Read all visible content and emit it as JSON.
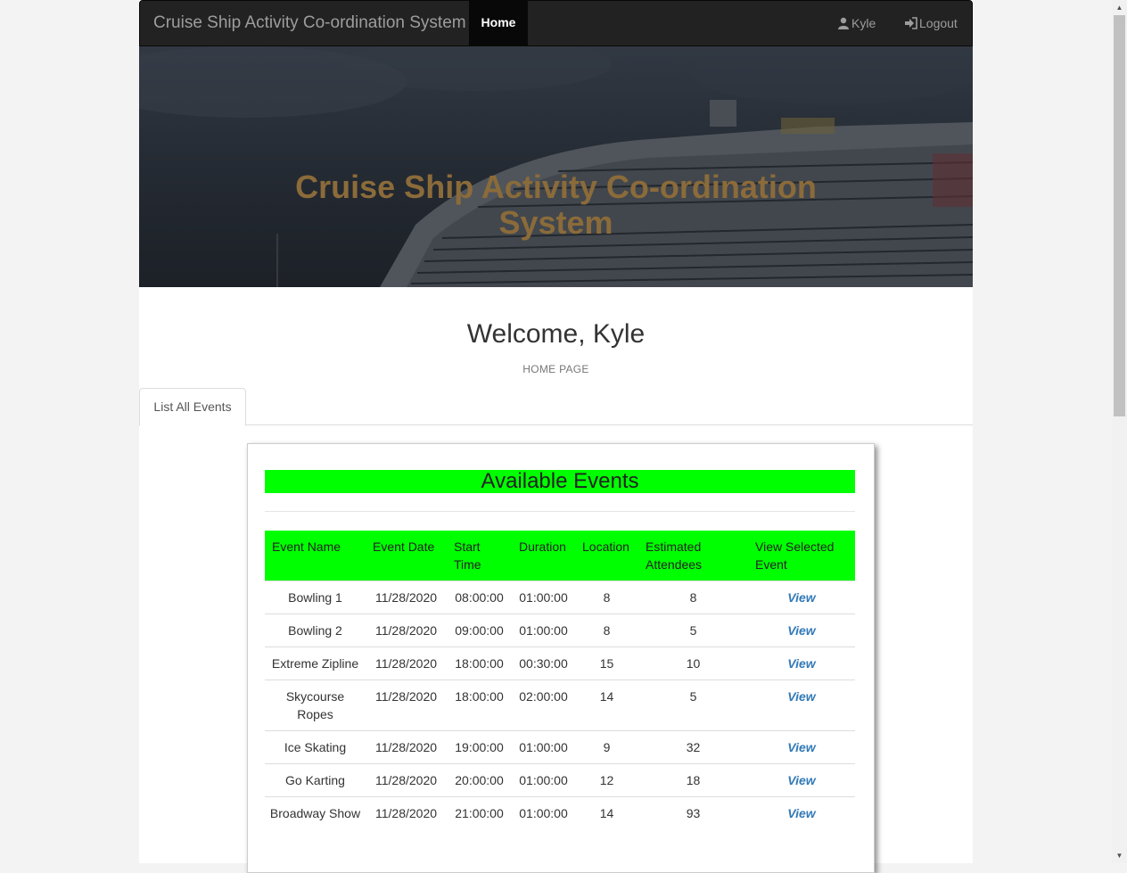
{
  "navbar": {
    "brand": "Cruise Ship Activity Co-ordination System",
    "home": "Home",
    "user": "Kyle",
    "logout": "Logout"
  },
  "hero": {
    "title": "Cruise Ship Activity Co-ordination System"
  },
  "welcome": "Welcome, Kyle",
  "subtitle": "HOME PAGE",
  "tabs": [
    {
      "label": "List All Events"
    }
  ],
  "events": {
    "heading": "Available Events",
    "columns": [
      "Event Name",
      "Event Date",
      "Start Time",
      "Duration",
      "Location",
      "Estimated Attendees",
      "View Selected Event"
    ],
    "rows": [
      {
        "name": "Bowling 1",
        "date": "11/28/2020",
        "start": "08:00:00",
        "duration": "01:00:00",
        "location": "8",
        "attendees": "8",
        "view": "View"
      },
      {
        "name": "Bowling 2",
        "date": "11/28/2020",
        "start": "09:00:00",
        "duration": "01:00:00",
        "location": "8",
        "attendees": "5",
        "view": "View"
      },
      {
        "name": "Extreme Zipline",
        "date": "11/28/2020",
        "start": "18:00:00",
        "duration": "00:30:00",
        "location": "15",
        "attendees": "10",
        "view": "View"
      },
      {
        "name": "Skycourse Ropes",
        "date": "11/28/2020",
        "start": "18:00:00",
        "duration": "02:00:00",
        "location": "14",
        "attendees": "5",
        "view": "View"
      },
      {
        "name": "Ice Skating",
        "date": "11/28/2020",
        "start": "19:00:00",
        "duration": "01:00:00",
        "location": "9",
        "attendees": "32",
        "view": "View"
      },
      {
        "name": "Go Karting",
        "date": "11/28/2020",
        "start": "20:00:00",
        "duration": "01:00:00",
        "location": "12",
        "attendees": "18",
        "view": "View"
      },
      {
        "name": "Broadway Show",
        "date": "11/28/2020",
        "start": "21:00:00",
        "duration": "01:00:00",
        "location": "14",
        "attendees": "93",
        "view": "View"
      }
    ]
  },
  "colors": {
    "accent": "#00ff00",
    "link": "#337ab7",
    "navbar": "#222222",
    "heroTitle": "#8b6b3a"
  }
}
